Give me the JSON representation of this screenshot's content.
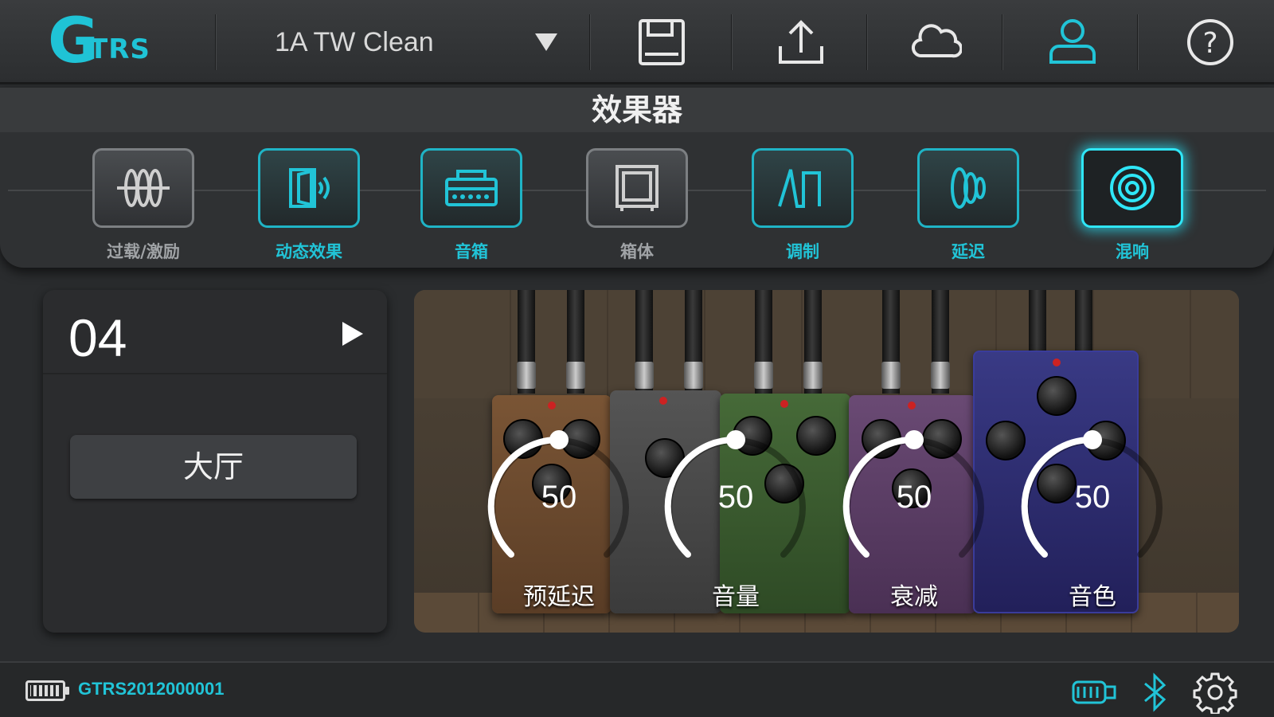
{
  "app": {
    "logo_text": "G",
    "logo_sub": "TRS",
    "preset_name": "1A TW Clean"
  },
  "toolbar": {
    "icons": [
      "save-icon",
      "upload-icon",
      "cloud-icon",
      "user-icon",
      "help-icon"
    ]
  },
  "effects": {
    "title": "效果器",
    "items": [
      {
        "label": "过载/激励",
        "icon": "overdrive-icon",
        "state": "off"
      },
      {
        "label": "动态效果",
        "icon": "dynamics-icon",
        "state": "on"
      },
      {
        "label": "音箱",
        "icon": "amp-icon",
        "state": "on"
      },
      {
        "label": "箱体",
        "icon": "cabinet-icon",
        "state": "off"
      },
      {
        "label": "调制",
        "icon": "modulation-icon",
        "state": "on"
      },
      {
        "label": "延迟",
        "icon": "delay-icon",
        "state": "on"
      },
      {
        "label": "混响",
        "icon": "reverb-icon",
        "state": "selected"
      }
    ]
  },
  "info": {
    "slot": "04",
    "reverb_type": "大厅"
  },
  "params": [
    {
      "label": "预延迟",
      "value": "50"
    },
    {
      "label": "音量",
      "value": "50"
    },
    {
      "label": "衰减",
      "value": "50"
    },
    {
      "label": "音色",
      "value": "50"
    }
  ],
  "status": {
    "serial": "GTRS2012000001",
    "icons": [
      "guitar-connection-icon",
      "bluetooth-icon",
      "settings-icon"
    ]
  },
  "colors": {
    "accent": "#1fc3d6",
    "selected_glow": "#2fe6f7",
    "pedal_orange": "#6b4a30",
    "pedal_gray": "#4a4a4a",
    "pedal_green": "#3a5a30",
    "pedal_purple": "#5a3f63",
    "pedal_blue": "#2e2c6e"
  }
}
